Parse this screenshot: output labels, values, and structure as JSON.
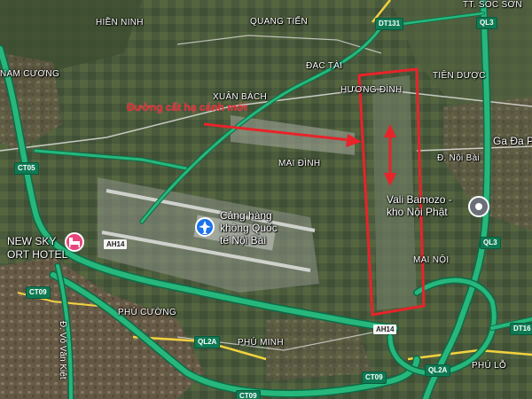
{
  "annotation": {
    "label": "Đường cất hạ cánh mới",
    "color": "#e8232a"
  },
  "places": {
    "hien_ninh": "HIỀN NINH",
    "quang_tien": "QUANG TIẾN",
    "tt_soc_son": "TT. SÓC SƠN",
    "nam_cuong": "NAM CƯƠNG",
    "dac_tai": "ĐẠC TÀI",
    "tien_duoc": "TIÊN DƯỢC",
    "xuan_bach": "XUÂN BÁCH",
    "huong_dinh": "HƯƠNG ĐÌNH",
    "ga_da_phuc": "Ga Đa P",
    "d_noi_bai": "Đ. Nội Bài",
    "mai_dinh": "MAI ĐÌNH",
    "vali": "Vali Bamozo -\nkho Nội Phật",
    "airport": "Cảng hàng\nkhông Quốc\ntế Nội Bài",
    "new_sky": "NEW SKY\nORT HOTEL",
    "mai_noi": "MAI NỘI",
    "phu_cuong": "PHÚ CƯỜNG",
    "phu_minh": "PHÚ MINH",
    "phu_lo": "PHÚ LỖ",
    "vo_van_kiet": "Đ. Võ Văn Kiệt"
  },
  "shields": {
    "dt131": "DT131",
    "ql3_top": "QL3",
    "ct05": "CT05",
    "ah14_left": "AH14",
    "ct09_left": "CT09",
    "ql3_mid": "QL3",
    "ah14_mid": "AH14",
    "ql2a_left": "QL2A",
    "dt16": "DT16",
    "ct09_bottom": "CT09",
    "ql2a_right": "QL2A",
    "ct09_foot": "CT09"
  },
  "colors": {
    "highway": "#27b77c",
    "highway_edge": "#0d6b47",
    "road_yellow": "#f2d23e",
    "road_white": "#e8e8e8"
  },
  "icons": {
    "airport": "airplane-icon",
    "hotel": "bed-icon",
    "place": "map-pin-icon"
  }
}
